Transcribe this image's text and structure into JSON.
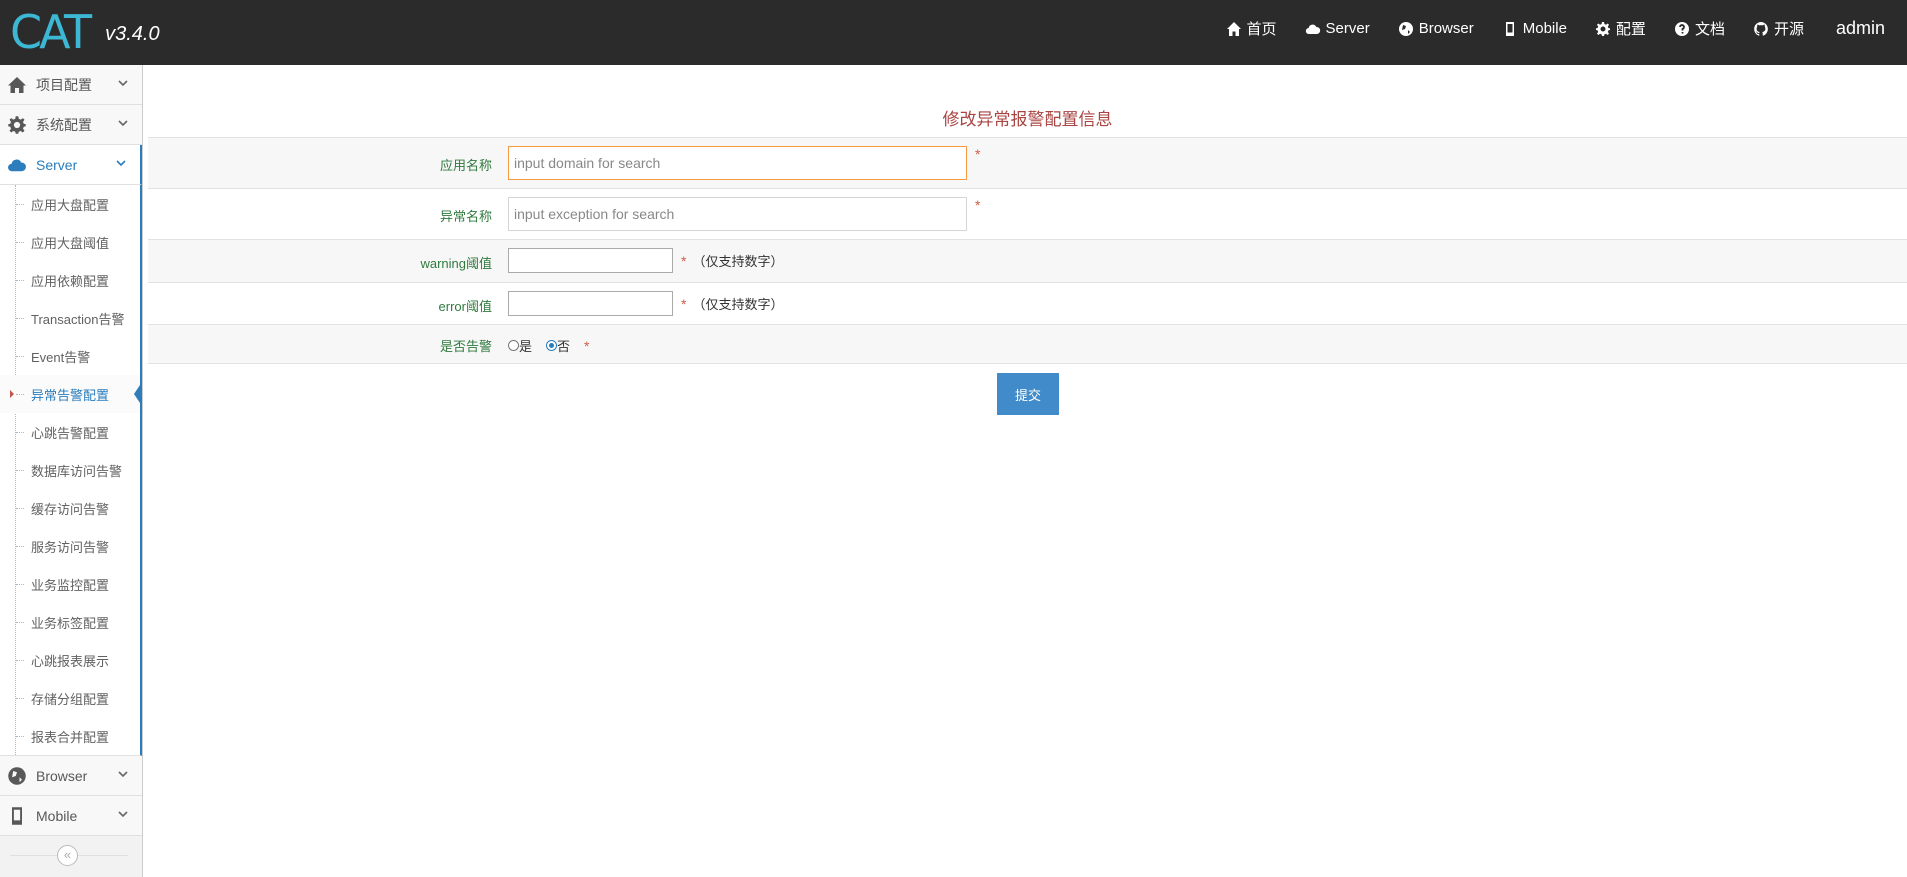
{
  "brand": {
    "logo": "CAT",
    "version": "v3.4.0"
  },
  "topnav": {
    "items": [
      {
        "label": "首页",
        "icon": "home-icon"
      },
      {
        "label": "Server",
        "icon": "cloud-icon"
      },
      {
        "label": "Browser",
        "icon": "globe-icon"
      },
      {
        "label": "Mobile",
        "icon": "mobile-icon"
      },
      {
        "label": "配置",
        "icon": "gear-icon"
      },
      {
        "label": "文档",
        "icon": "question-icon"
      },
      {
        "label": "开源",
        "icon": "github-icon"
      }
    ],
    "user": "admin"
  },
  "sidebar": {
    "top_items": [
      {
        "label": "项目配置",
        "icon": "home-icon"
      },
      {
        "label": "系统配置",
        "icon": "gear-icon"
      },
      {
        "label": "Server",
        "icon": "cloud-icon",
        "expanded": true
      }
    ],
    "server_items": [
      "应用大盘配置",
      "应用大盘阈值",
      "应用依赖配置",
      "Transaction告警",
      "Event告警",
      "异常告警配置",
      "心跳告警配置",
      "数据库访问告警",
      "缓存访问告警",
      "服务访问告警",
      "业务监控配置",
      "业务标签配置",
      "心跳报表展示",
      "存储分组配置",
      "报表合并配置"
    ],
    "active_item": "异常告警配置",
    "bottom_items": [
      {
        "label": "Browser",
        "icon": "globe-icon"
      },
      {
        "label": "Mobile",
        "icon": "mobile-icon"
      }
    ],
    "collapse_symbol": "«"
  },
  "form": {
    "title": "修改异常报警配置信息",
    "domain": {
      "label": "应用名称",
      "placeholder": "input domain for search",
      "required": "*"
    },
    "exception": {
      "label": "异常名称",
      "placeholder": "input exception for search",
      "required": "*"
    },
    "warning": {
      "label": "warning阈值",
      "required": "*",
      "hint": "（仅支持数字）"
    },
    "error": {
      "label": "error阈值",
      "required": "*",
      "hint": "（仅支持数字）"
    },
    "alarm": {
      "label": "是否告警",
      "yes": "是",
      "no": "否",
      "selected": "否",
      "required": "*"
    },
    "submit": "提交"
  },
  "colors": {
    "navbar": "#2b2b2b",
    "accent": "#2b7dbc",
    "title": "#a94442",
    "label": "#2f7a3f",
    "button": "#428bca"
  }
}
